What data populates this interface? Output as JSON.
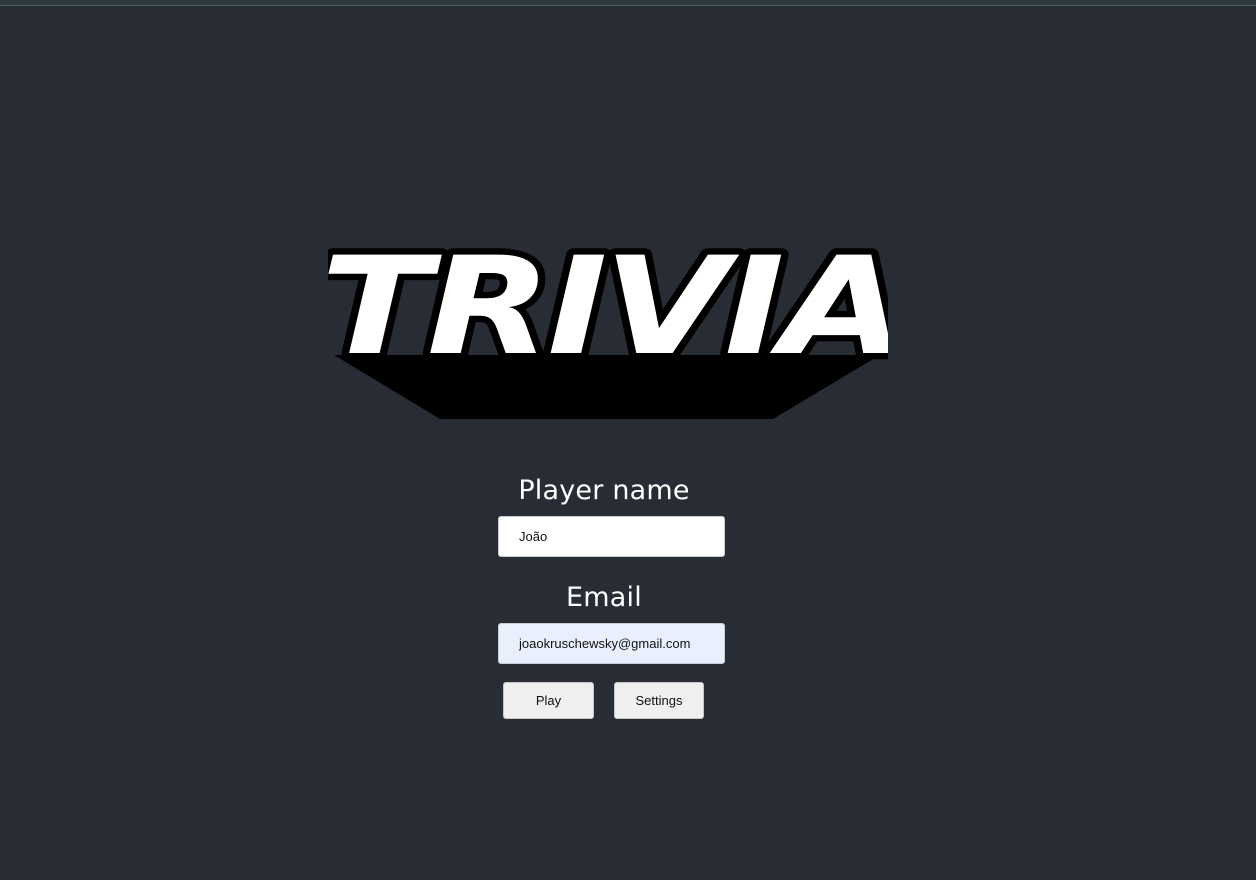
{
  "logo": {
    "text": "TRIVIA",
    "fill_color": "#ffffff",
    "outline_color": "#000000"
  },
  "login": {
    "player_name_label": "Player name",
    "player_name_value": "João",
    "email_label": "Email",
    "email_value": "joaokruschewsky@gmail.com"
  },
  "buttons": {
    "play_label": "Play",
    "settings_label": "Settings"
  },
  "colors": {
    "background": "#282c34",
    "autofill_background": "#e8f0fe"
  }
}
